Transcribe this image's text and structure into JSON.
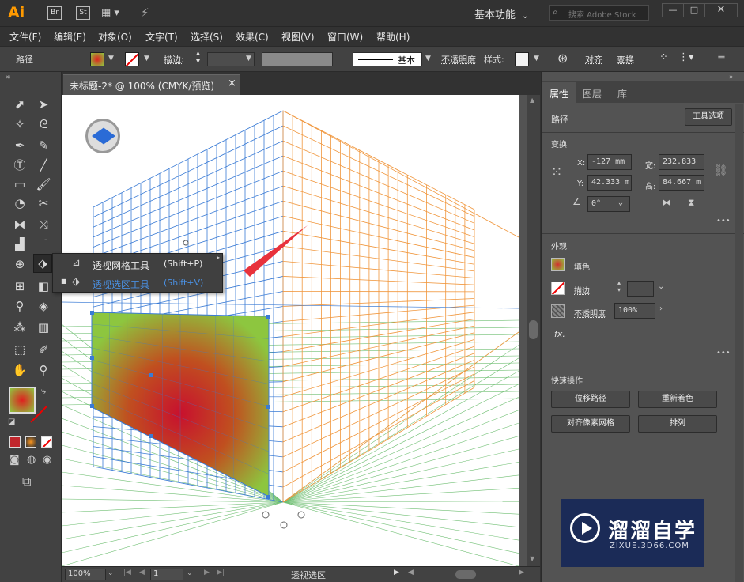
{
  "app": {
    "logo": "Ai",
    "br": "Br",
    "st": "St",
    "workspace": "基本功能",
    "search_placeholder": "搜索 Adobe Stock"
  },
  "menu": [
    "文件(F)",
    "编辑(E)",
    "对象(O)",
    "文字(T)",
    "选择(S)",
    "效果(C)",
    "视图(V)",
    "窗口(W)",
    "帮助(H)"
  ],
  "control": {
    "object_type": "路径",
    "stroke_label": "描边:",
    "stroke_style": "基本",
    "opacity_label": "不透明度",
    "style_label": "样式:",
    "align_label": "对齐",
    "transform_label": "变换"
  },
  "document": {
    "tab_title": "未标题-2* @ 100% (CMYK/预览)",
    "close_glyph": "×"
  },
  "flyout": {
    "items": [
      {
        "label": "透视网格工具",
        "shortcut": "(Shift+P)"
      },
      {
        "label": "透视选区工具",
        "shortcut": "(Shift+V)"
      }
    ]
  },
  "status": {
    "zoom": "100%",
    "page": "1",
    "tool_name": "透视选区"
  },
  "panel": {
    "tabs": [
      "属性",
      "图层",
      "库"
    ],
    "object_type": "路径",
    "tool_options_btn": "工具选项",
    "transform": {
      "title": "变换",
      "x_label": "X:",
      "x_value": "-127 mm",
      "y_label": "Y:",
      "y_value": "42.333 m",
      "w_label": "宽:",
      "w_value": "232.833",
      "h_label": "高:",
      "h_value": "84.667 m",
      "angle_value": "0°"
    },
    "appearance": {
      "title": "外观",
      "fill_label": "填色",
      "stroke_label": "描边",
      "opacity_label": "不透明度",
      "opacity_value": "100%",
      "fx_label": "fx."
    },
    "quick": {
      "title": "快速操作",
      "buttons": [
        "位移路径",
        "重新着色",
        "对齐像素网格",
        "排列"
      ]
    },
    "more_glyph": "•••"
  },
  "watermark": {
    "title": "溜溜自学",
    "subtitle": "ZIXUE.3D66.COM"
  },
  "colors": {
    "chrome_dark": "#323232",
    "chrome_mid": "#424242",
    "panel": "#535353",
    "grid_left": "#3a7bd5",
    "grid_right": "#f0963c",
    "grid_ground": "#4caf50",
    "accent_blue": "#4a90e2"
  }
}
